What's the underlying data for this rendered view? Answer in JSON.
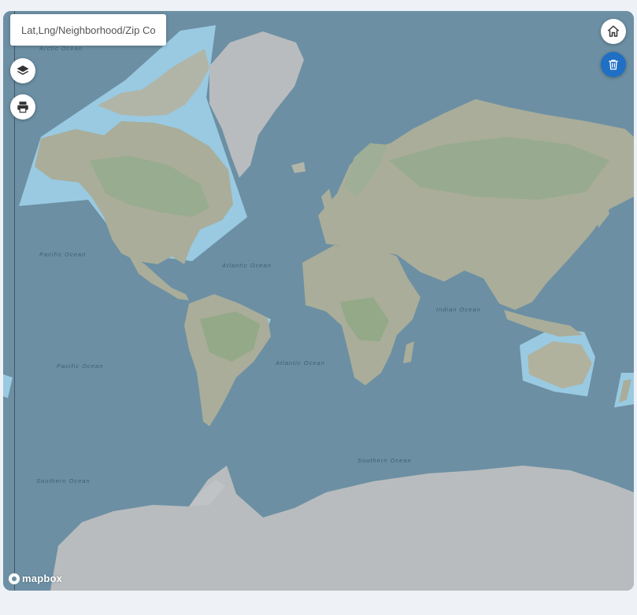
{
  "search": {
    "placeholder": "Lat,Lng/Neighborhood/Zip Cod"
  },
  "controls": {
    "layers": "layers-icon",
    "print": "printer-icon",
    "home": "home-icon",
    "trash": "trash-icon"
  },
  "ocean_labels": {
    "arctic": "Arctic Ocean",
    "pacific_north": "Pacific Ocean",
    "atlantic_north": "Atlantic Ocean",
    "indian": "Indian Ocean",
    "pacific_south": "Pacific Ocean",
    "atlantic_south": "Atlantic Ocean",
    "southern_left": "Southern Ocean",
    "southern_right": "Southern Ocean"
  },
  "attribution": {
    "logo_text": "mapbox"
  },
  "colors": {
    "ocean": "#6c8fa3",
    "land": "#a9ad9a",
    "ice": "#b8bcbe",
    "vegetation": "#8ea788",
    "selection_fill": "#9ccde6",
    "trash_button": "#1f6fc4"
  }
}
